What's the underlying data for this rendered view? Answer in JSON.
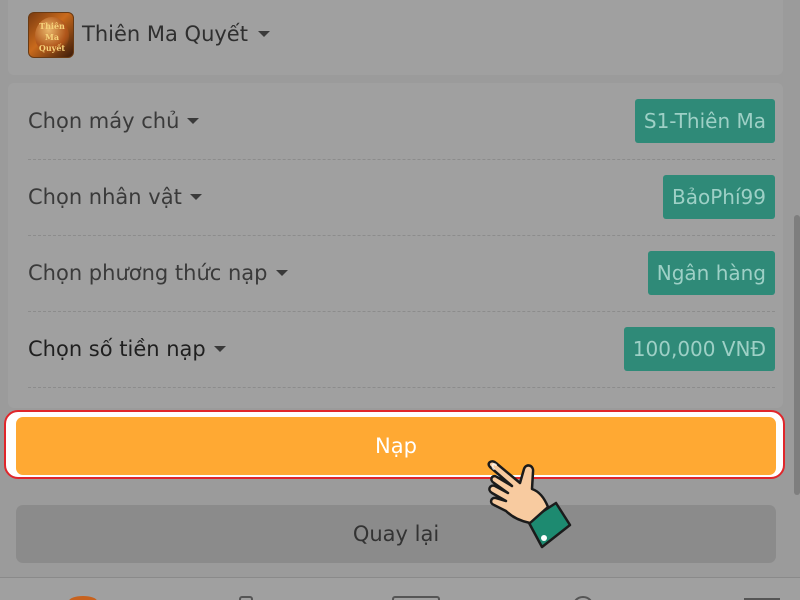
{
  "header": {
    "game_name": "Thiên Ma Quyết",
    "logo_text": "Thiên Ma Quyết"
  },
  "form": {
    "rows": [
      {
        "label": "Chọn máy chủ",
        "value": "S1-Thiên Ma"
      },
      {
        "label": "Chọn nhân vật",
        "value": "BảoPhí99"
      },
      {
        "label": "Chọn phương thức nạp",
        "value": "Ngân hàng"
      },
      {
        "label": "Chọn số tiền nạp",
        "value": "100,000 VNĐ"
      }
    ]
  },
  "actions": {
    "submit_label": "Nạp",
    "back_label": "Quay lại"
  },
  "colors": {
    "accent": "#ffa933",
    "pill": "#2f8a78",
    "highlight": "#e0262b"
  },
  "icons": {
    "pointer": "hand-pointer-icon",
    "dropdown": "caret-down-icon"
  }
}
